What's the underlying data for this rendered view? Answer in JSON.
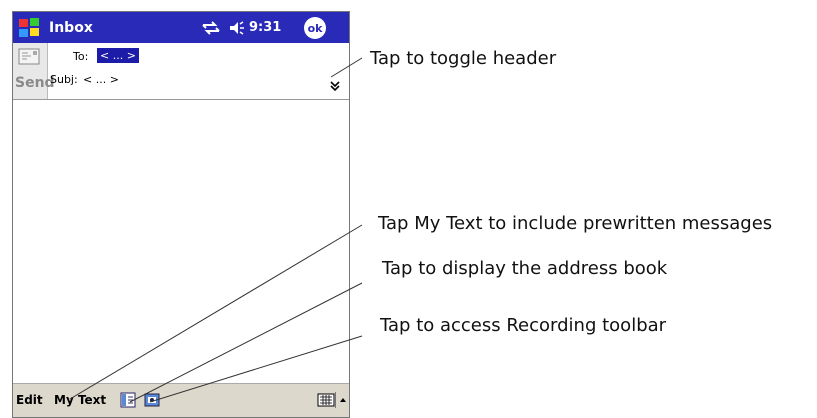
{
  "titlebar": {
    "title": "Inbox",
    "time": "9:31",
    "ok_label": "ok"
  },
  "header": {
    "send_label": "Send",
    "to_label": "To:",
    "to_value": "< ... >",
    "subject_label": "Subj:",
    "subject_value": "< ... >"
  },
  "bottombar": {
    "edit_label": "Edit",
    "mytext_label": "My Text"
  },
  "callouts": {
    "toggle_header": "Tap to toggle header",
    "my_text": "Tap My Text to include prewritten messages",
    "address_book": "Tap to display the address book",
    "recording": "Tap to access Recording toolbar"
  },
  "colors": {
    "titlebar": "#2a2ab8",
    "selection": "#1c1ca8",
    "bottombar": "#dcd8cc"
  },
  "icons": [
    "windows-start-icon",
    "sync-icon",
    "volume-icon",
    "envelope-icon",
    "double-chevron-down-icon",
    "address-book-icon",
    "recording-icon",
    "keyboard-icon",
    "up-arrow-icon"
  ]
}
